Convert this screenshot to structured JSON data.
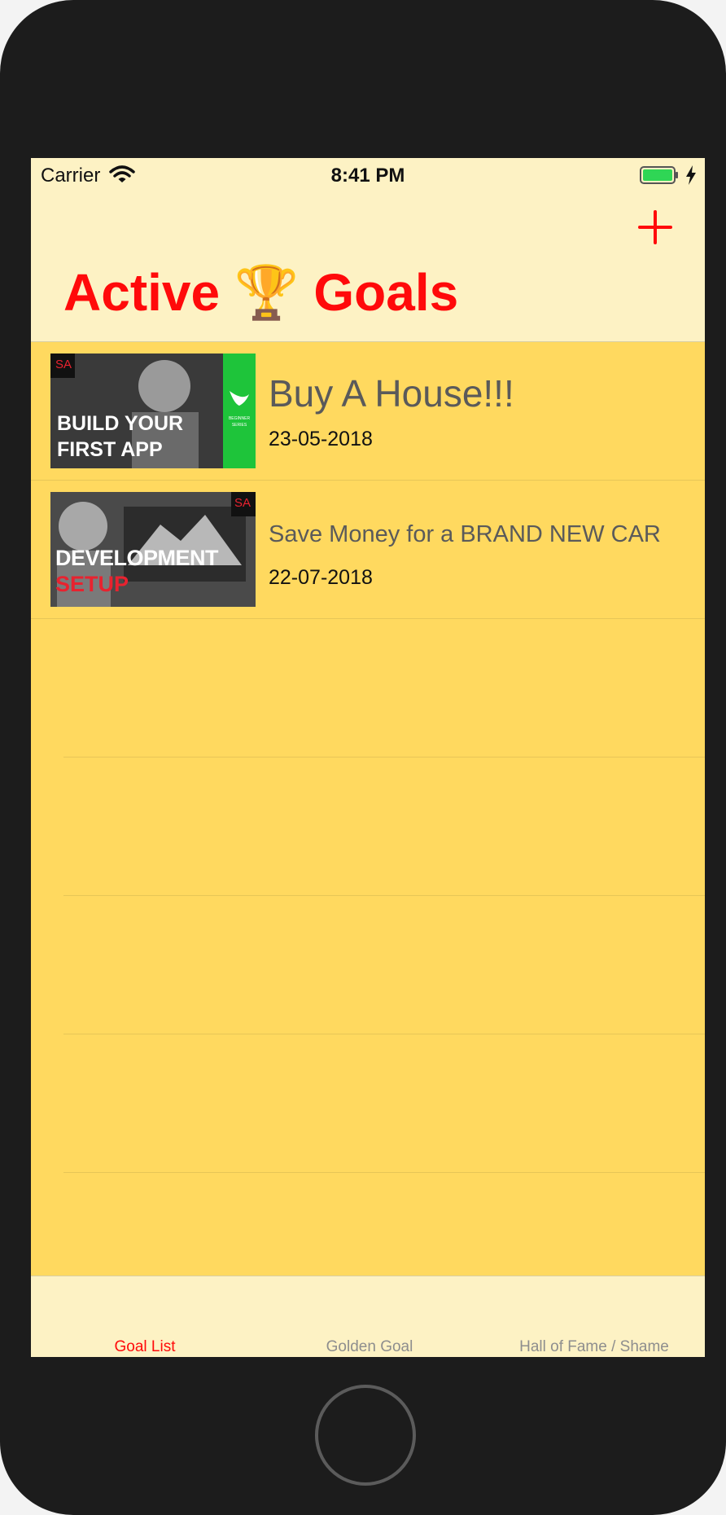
{
  "status_bar": {
    "carrier": "Carrier",
    "time": "8:41 PM"
  },
  "nav": {
    "title": "Active 🏆 Goals"
  },
  "goals": [
    {
      "title": "Buy A House!!!",
      "date": "23-05-2018",
      "thumbnail": {
        "badge": "SA",
        "line1": "BUILD YOUR",
        "line2": "FIRST APP",
        "side_text": "BEGINNER SERIES",
        "side_color": "#1ec43a"
      }
    },
    {
      "title": "Save Money for a BRAND NEW CAR",
      "date": "22-07-2018",
      "thumbnail": {
        "badge": "SA",
        "line1": "DEVELOPMENT",
        "line2": "SETUP",
        "line2_color": "#e8222f"
      }
    }
  ],
  "tabs": [
    {
      "label": "Goal List",
      "active": true
    },
    {
      "label": "Golden Goal",
      "active": false
    },
    {
      "label": "Hall of Fame / Shame",
      "active": false
    }
  ],
  "colors": {
    "accent": "#ff0a0a",
    "list_background": "#ffd95f",
    "bar_background": "#fdf2c4"
  }
}
